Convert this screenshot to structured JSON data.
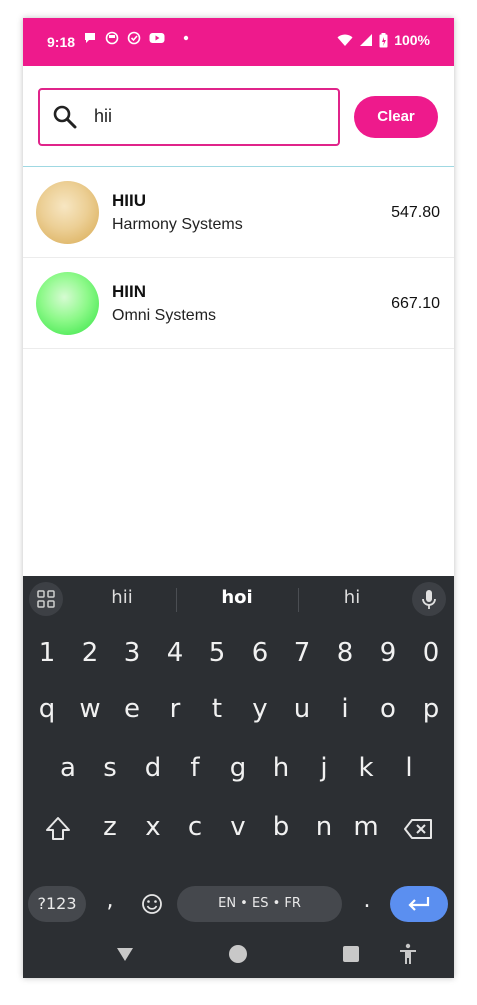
{
  "status_bar": {
    "time": "9:18",
    "battery": "100%",
    "icons": [
      "chat-bubble-icon",
      "notification-icon",
      "check-circle-icon",
      "youtube-icon",
      "dot-icon",
      "wifi-icon",
      "signal-icon",
      "battery-icon"
    ]
  },
  "search": {
    "value": "hii",
    "clear_label": "Clear"
  },
  "results": [
    {
      "symbol": "HIIU",
      "company": "Harmony Systems",
      "price": "547.80",
      "avatar_color": "#e5bd72"
    },
    {
      "symbol": "HIIN",
      "company": "Omni Systems",
      "price": "667.10",
      "avatar_color": "#5cf26a"
    }
  ],
  "keyboard": {
    "suggestions": [
      "hii",
      "hoi",
      "hi"
    ],
    "number_row": [
      "1",
      "2",
      "3",
      "4",
      "5",
      "6",
      "7",
      "8",
      "9",
      "0"
    ],
    "row1": [
      "q",
      "w",
      "e",
      "r",
      "t",
      "y",
      "u",
      "i",
      "o",
      "p"
    ],
    "row2": [
      "a",
      "s",
      "d",
      "f",
      "g",
      "h",
      "j",
      "k",
      "l"
    ],
    "row3": [
      "z",
      "x",
      "c",
      "v",
      "b",
      "n",
      "m"
    ],
    "symbols_label": "?123",
    "comma": ",",
    "period": ".",
    "space_label": "EN • ES • FR"
  },
  "colors": {
    "accent": "#ee1a8c",
    "keyboard_bg": "#2c2f33",
    "enter_key": "#5b8ff0"
  }
}
